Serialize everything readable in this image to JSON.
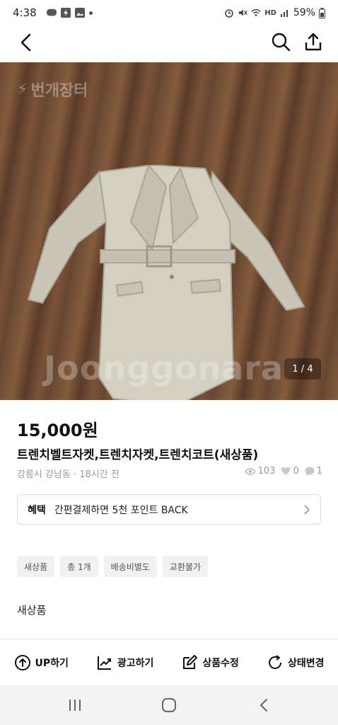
{
  "status_bar": {
    "time": "4:38",
    "battery": "59%",
    "network_label": "HD"
  },
  "image": {
    "watermark_top": "번개장터",
    "watermark_center": "Joonggonara",
    "counter": "1 / 4"
  },
  "product": {
    "price": "15,000원",
    "title": "트렌치벨트자켓,트렌치자켓,트렌치코트(새상품)",
    "location_time": "강릉시 강남동 · 18시간 전",
    "views": "103",
    "likes": "0",
    "chats": "1"
  },
  "benefit": {
    "tag": "혜택",
    "text": "간편결제하면 5천 포인트 BACK"
  },
  "chips": [
    "새상품",
    "총 1개",
    "배송비별도",
    "교환불가"
  ],
  "description": "새상품",
  "actions": {
    "up": "UP하기",
    "ad": "광고하기",
    "edit": "상품수정",
    "status": "상태변경"
  },
  "colors": {
    "accent": "#111111",
    "muted": "#9a9a9a",
    "chip_bg": "#f1f1f1"
  }
}
